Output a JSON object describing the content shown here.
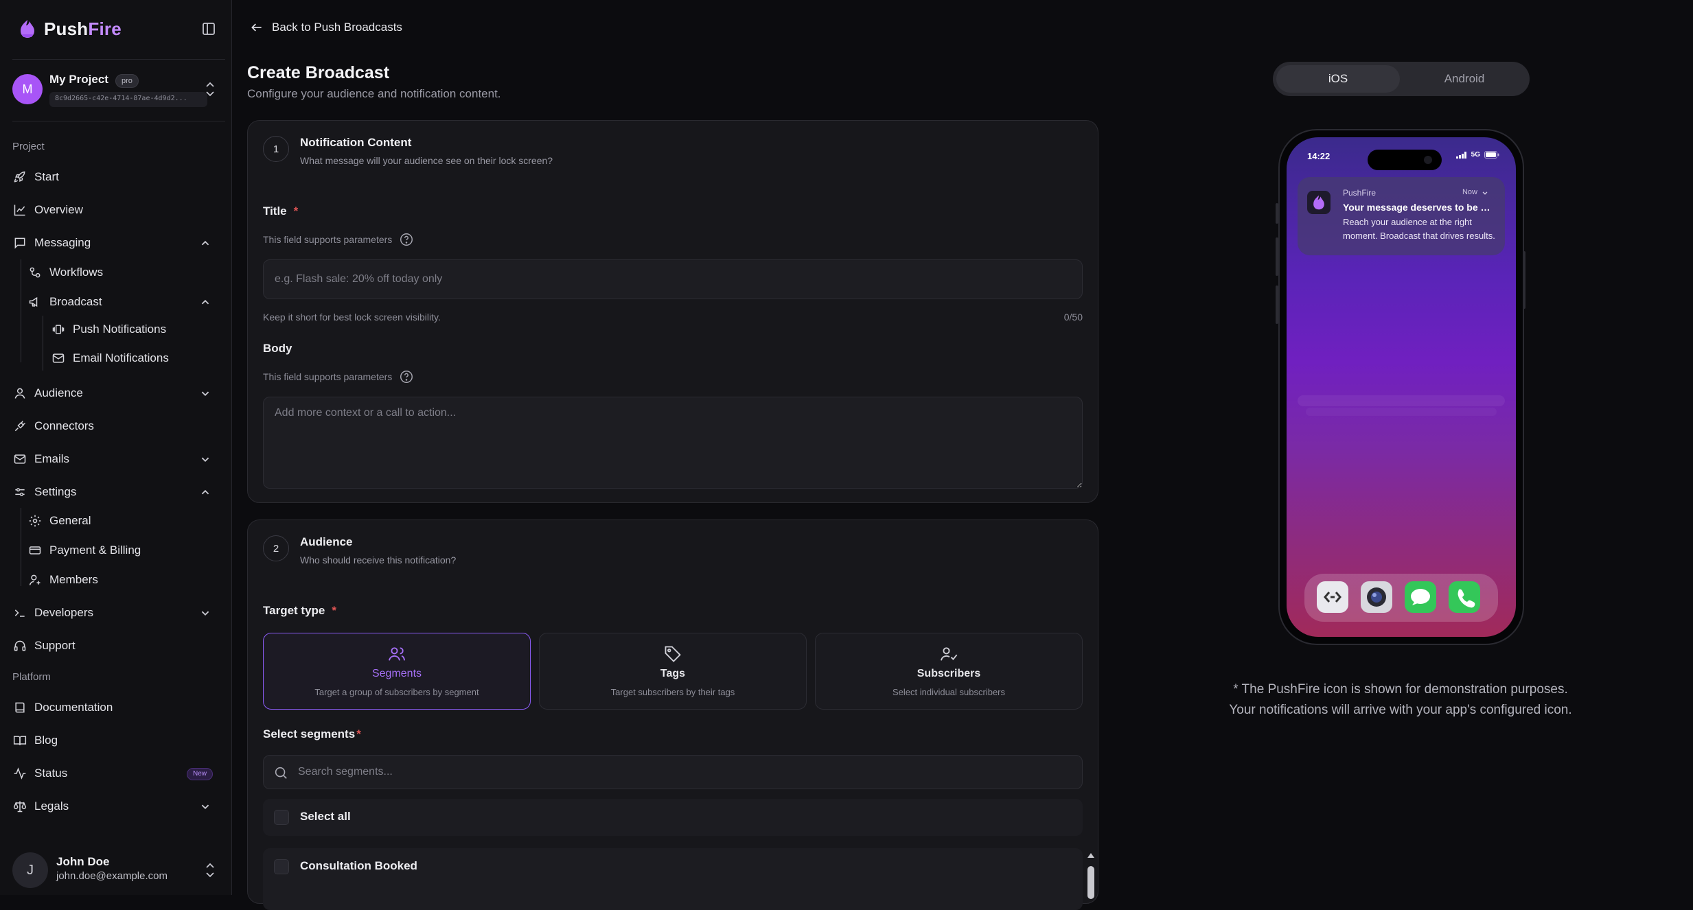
{
  "brand": {
    "name_part1": "Push",
    "name_part2": "Fire"
  },
  "project": {
    "avatar": "M",
    "name": "My Project",
    "badge": "pro",
    "id": "8c9d2665-c42e-4714-87ae-4d9d2..."
  },
  "sidebar": {
    "section_project": "Project",
    "section_platform": "Platform",
    "start": "Start",
    "overview": "Overview",
    "messaging": "Messaging",
    "workflows": "Workflows",
    "broadcast": "Broadcast",
    "push_notifications": "Push Notifications",
    "email_notifications": "Email Notifications",
    "audience": "Audience",
    "connectors": "Connectors",
    "emails": "Emails",
    "settings": "Settings",
    "general": "General",
    "payment_billing": "Payment & Billing",
    "members": "Members",
    "developers": "Developers",
    "support": "Support",
    "documentation": "Documentation",
    "blog": "Blog",
    "status": "Status",
    "status_badge": "New",
    "legals": "Legals"
  },
  "user": {
    "avatar": "J",
    "name": "John Doe",
    "email": "john.doe@example.com"
  },
  "header": {
    "back_label": "Back to Push Broadcasts",
    "title": "Create Broadcast",
    "subtitle": "Configure your audience and notification content."
  },
  "content_card": {
    "step": "1",
    "title": "Notification Content",
    "subtitle": "What message will your audience see on their lock screen?",
    "title_label": "Title",
    "required_mark": "*",
    "params_hint": "This field supports parameters",
    "title_placeholder": "e.g. Flash sale: 20% off today only",
    "title_hint": "Keep it short for best lock screen visibility.",
    "title_count": "0/50",
    "body_label": "Body",
    "body_placeholder": "Add more context or a call to action..."
  },
  "audience_card": {
    "step": "2",
    "title": "Audience",
    "subtitle": "Who should receive this notification?",
    "target_label": "Target type",
    "required_mark": "*",
    "options": [
      {
        "title": "Segments",
        "desc": "Target a group of subscribers by segment"
      },
      {
        "title": "Tags",
        "desc": "Target subscribers by their tags"
      },
      {
        "title": "Subscribers",
        "desc": "Select individual subscribers"
      }
    ],
    "segments_label": "Select segments",
    "search_placeholder": "Search segments...",
    "select_all": "Select all",
    "segments": [
      "Consultation Booked"
    ]
  },
  "preview": {
    "tabs": [
      "iOS",
      "Android"
    ],
    "active_tab": "iOS",
    "phone": {
      "time": "14:22",
      "network": "5G"
    },
    "notification": {
      "app": "PushFire",
      "time": "Now",
      "title": "Your message deserves to be heard",
      "body": "Reach your audience at the right moment. Broadcast that drives results."
    },
    "note_line1": "* The PushFire icon is shown for demonstration purposes.",
    "note_line2": "Your notifications will arrive with your app's configured icon."
  },
  "colors": {
    "accent": "#a855f7",
    "background": "#0c0c0f",
    "card": "#17171b",
    "required": "#e05555"
  }
}
